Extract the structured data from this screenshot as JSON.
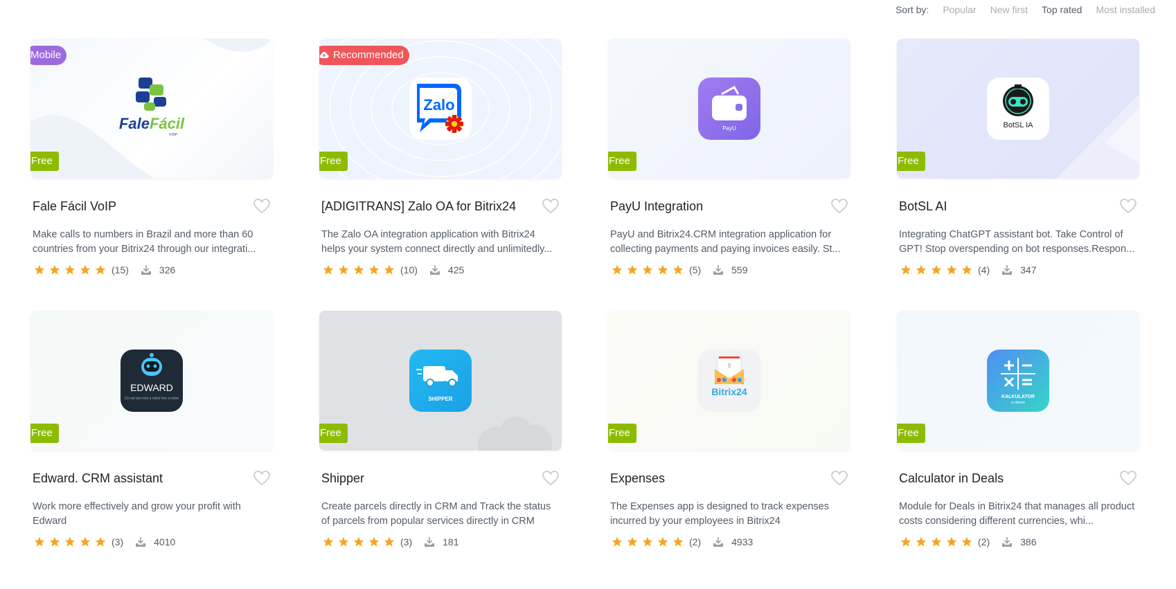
{
  "sort": {
    "label": "Sort by:",
    "options": [
      "Popular",
      "New first",
      "Top rated",
      "Most installed"
    ],
    "active": "Top rated"
  },
  "cards": [
    {
      "title": "Fale Fácil VoIP",
      "description": "Make calls to numbers in Brazil and more than 60 countries from your Bitrix24 through our integrati...",
      "reviews": "(15)",
      "installs": "326",
      "badge": "Free",
      "ribbon": "Mobile",
      "icon": "falefacil-logo"
    },
    {
      "title": "[ADIGITRANS] Zalo OA for Bitrix24",
      "description": "The Zalo OA integration application with Bitrix24 helps your system connect directly and unlimitedly...",
      "reviews": "(10)",
      "installs": "425",
      "badge": "Free",
      "ribbon": "Recommended",
      "icon": "zalo-logo"
    },
    {
      "title": "PayU Integration",
      "description": "PayU and Bitrix24.CRM integration application for collecting payments and paying invoices easily. St...",
      "reviews": "(5)",
      "installs": "559",
      "badge": "Free",
      "icon": "payu-wallet-logo",
      "icon_caption": "PayU"
    },
    {
      "title": "BotSL AI",
      "description": "Integrating ChatGPT assistant bot. Take Control of GPT! Stop overspending on bot responses.Respon...",
      "reviews": "(4)",
      "installs": "347",
      "badge": "Free",
      "icon": "botsl-robot-logo",
      "icon_caption": "BotSL IA"
    },
    {
      "title": "Edward. CRM assistant",
      "description": "Work more effectively and grow your profit with Edward",
      "reviews": "(3)",
      "installs": "4010",
      "badge": "Free",
      "icon": "edward-robot-logo",
      "icon_caption": "EDWARD",
      "icon_sub": "Do not turn into a robot hire a robot"
    },
    {
      "title": "Shipper",
      "description": "Create parcels directly in CRM and Track the status of parcels from popular services directly in CRM",
      "reviews": "(3)",
      "installs": "181",
      "badge": "Free",
      "icon": "shipper-truck-logo",
      "icon_caption": "SHIPPER"
    },
    {
      "title": "Expenses",
      "description": "The Expenses app is designed to track expenses incurred by your employees in Bitrix24",
      "reviews": "(2)",
      "installs": "4933",
      "badge": "Free",
      "icon": "bitrix24-envelope-logo",
      "icon_caption": "Bitrix24"
    },
    {
      "title": "Calculator in Deals",
      "description": "Module for Deals in Bitrix24 that manages all product costs considering different currencies, whi...",
      "reviews": "(2)",
      "installs": "386",
      "badge": "Free",
      "icon": "calculator-logo",
      "icon_caption": "KALKULATOR",
      "icon_sub": "w ofercie"
    }
  ],
  "colors": {
    "free_badge": "#8dbb00",
    "mobile_ribbon": "#9b6bde",
    "recommended_ribbon": "#f0555a",
    "star": "#f5a623",
    "text_secondary": "#535c69"
  }
}
